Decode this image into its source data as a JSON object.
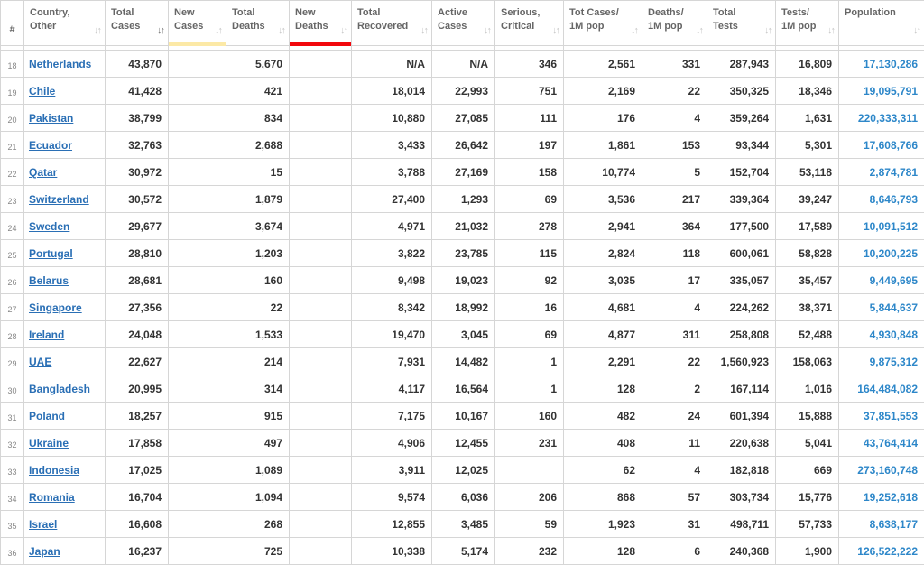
{
  "columns": [
    {
      "key": "rank",
      "l1": "#",
      "l2": ""
    },
    {
      "key": "country",
      "l1": "Country,",
      "l2": "Other"
    },
    {
      "key": "total_cases",
      "l1": "Total",
      "l2": "Cases"
    },
    {
      "key": "new_cases",
      "l1": "New",
      "l2": "Cases"
    },
    {
      "key": "total_deaths",
      "l1": "Total",
      "l2": "Deaths"
    },
    {
      "key": "new_deaths",
      "l1": "New",
      "l2": "Deaths"
    },
    {
      "key": "total_recovered",
      "l1": "Total",
      "l2": "Recovered"
    },
    {
      "key": "active_cases",
      "l1": "Active",
      "l2": "Cases"
    },
    {
      "key": "serious",
      "l1": "Serious,",
      "l2": "Critical"
    },
    {
      "key": "cases_per_m",
      "l1": "Tot Cases/",
      "l2": "1M pop"
    },
    {
      "key": "deaths_per_m",
      "l1": "Deaths/",
      "l2": "1M pop"
    },
    {
      "key": "total_tests",
      "l1": "Total",
      "l2": "Tests"
    },
    {
      "key": "tests_per_m",
      "l1": "Tests/",
      "l2": "1M pop"
    },
    {
      "key": "population",
      "l1": "Population",
      "l2": ""
    }
  ],
  "sort_glyph": "↓↑",
  "rows": [
    {
      "rank": "18",
      "country": "Netherlands",
      "total_cases": "43,870",
      "new_cases": "",
      "total_deaths": "5,670",
      "new_deaths": "",
      "total_recovered": "N/A",
      "active_cases": "N/A",
      "serious": "346",
      "cases_per_m": "2,561",
      "deaths_per_m": "331",
      "total_tests": "287,943",
      "tests_per_m": "16,809",
      "population": "17,130,286"
    },
    {
      "rank": "19",
      "country": "Chile",
      "total_cases": "41,428",
      "new_cases": "",
      "total_deaths": "421",
      "new_deaths": "",
      "total_recovered": "18,014",
      "active_cases": "22,993",
      "serious": "751",
      "cases_per_m": "2,169",
      "deaths_per_m": "22",
      "total_tests": "350,325",
      "tests_per_m": "18,346",
      "population": "19,095,791"
    },
    {
      "rank": "20",
      "country": "Pakistan",
      "total_cases": "38,799",
      "new_cases": "",
      "total_deaths": "834",
      "new_deaths": "",
      "total_recovered": "10,880",
      "active_cases": "27,085",
      "serious": "111",
      "cases_per_m": "176",
      "deaths_per_m": "4",
      "total_tests": "359,264",
      "tests_per_m": "1,631",
      "population": "220,333,311"
    },
    {
      "rank": "21",
      "country": "Ecuador",
      "total_cases": "32,763",
      "new_cases": "",
      "total_deaths": "2,688",
      "new_deaths": "",
      "total_recovered": "3,433",
      "active_cases": "26,642",
      "serious": "197",
      "cases_per_m": "1,861",
      "deaths_per_m": "153",
      "total_tests": "93,344",
      "tests_per_m": "5,301",
      "population": "17,608,766"
    },
    {
      "rank": "22",
      "country": "Qatar",
      "total_cases": "30,972",
      "new_cases": "",
      "total_deaths": "15",
      "new_deaths": "",
      "total_recovered": "3,788",
      "active_cases": "27,169",
      "serious": "158",
      "cases_per_m": "10,774",
      "deaths_per_m": "5",
      "total_tests": "152,704",
      "tests_per_m": "53,118",
      "population": "2,874,781"
    },
    {
      "rank": "23",
      "country": "Switzerland",
      "total_cases": "30,572",
      "new_cases": "",
      "total_deaths": "1,879",
      "new_deaths": "",
      "total_recovered": "27,400",
      "active_cases": "1,293",
      "serious": "69",
      "cases_per_m": "3,536",
      "deaths_per_m": "217",
      "total_tests": "339,364",
      "tests_per_m": "39,247",
      "population": "8,646,793"
    },
    {
      "rank": "24",
      "country": "Sweden",
      "total_cases": "29,677",
      "new_cases": "",
      "total_deaths": "3,674",
      "new_deaths": "",
      "total_recovered": "4,971",
      "active_cases": "21,032",
      "serious": "278",
      "cases_per_m": "2,941",
      "deaths_per_m": "364",
      "total_tests": "177,500",
      "tests_per_m": "17,589",
      "population": "10,091,512"
    },
    {
      "rank": "25",
      "country": "Portugal",
      "total_cases": "28,810",
      "new_cases": "",
      "total_deaths": "1,203",
      "new_deaths": "",
      "total_recovered": "3,822",
      "active_cases": "23,785",
      "serious": "115",
      "cases_per_m": "2,824",
      "deaths_per_m": "118",
      "total_tests": "600,061",
      "tests_per_m": "58,828",
      "population": "10,200,225"
    },
    {
      "rank": "26",
      "country": "Belarus",
      "total_cases": "28,681",
      "new_cases": "",
      "total_deaths": "160",
      "new_deaths": "",
      "total_recovered": "9,498",
      "active_cases": "19,023",
      "serious": "92",
      "cases_per_m": "3,035",
      "deaths_per_m": "17",
      "total_tests": "335,057",
      "tests_per_m": "35,457",
      "population": "9,449,695"
    },
    {
      "rank": "27",
      "country": "Singapore",
      "total_cases": "27,356",
      "new_cases": "",
      "total_deaths": "22",
      "new_deaths": "",
      "total_recovered": "8,342",
      "active_cases": "18,992",
      "serious": "16",
      "cases_per_m": "4,681",
      "deaths_per_m": "4",
      "total_tests": "224,262",
      "tests_per_m": "38,371",
      "population": "5,844,637"
    },
    {
      "rank": "28",
      "country": "Ireland",
      "total_cases": "24,048",
      "new_cases": "",
      "total_deaths": "1,533",
      "new_deaths": "",
      "total_recovered": "19,470",
      "active_cases": "3,045",
      "serious": "69",
      "cases_per_m": "4,877",
      "deaths_per_m": "311",
      "total_tests": "258,808",
      "tests_per_m": "52,488",
      "population": "4,930,848"
    },
    {
      "rank": "29",
      "country": "UAE",
      "total_cases": "22,627",
      "new_cases": "",
      "total_deaths": "214",
      "new_deaths": "",
      "total_recovered": "7,931",
      "active_cases": "14,482",
      "serious": "1",
      "cases_per_m": "2,291",
      "deaths_per_m": "22",
      "total_tests": "1,560,923",
      "tests_per_m": "158,063",
      "population": "9,875,312"
    },
    {
      "rank": "30",
      "country": "Bangladesh",
      "total_cases": "20,995",
      "new_cases": "",
      "total_deaths": "314",
      "new_deaths": "",
      "total_recovered": "4,117",
      "active_cases": "16,564",
      "serious": "1",
      "cases_per_m": "128",
      "deaths_per_m": "2",
      "total_tests": "167,114",
      "tests_per_m": "1,016",
      "population": "164,484,082"
    },
    {
      "rank": "31",
      "country": "Poland",
      "total_cases": "18,257",
      "new_cases": "",
      "total_deaths": "915",
      "new_deaths": "",
      "total_recovered": "7,175",
      "active_cases": "10,167",
      "serious": "160",
      "cases_per_m": "482",
      "deaths_per_m": "24",
      "total_tests": "601,394",
      "tests_per_m": "15,888",
      "population": "37,851,553"
    },
    {
      "rank": "32",
      "country": "Ukraine",
      "total_cases": "17,858",
      "new_cases": "",
      "total_deaths": "497",
      "new_deaths": "",
      "total_recovered": "4,906",
      "active_cases": "12,455",
      "serious": "231",
      "cases_per_m": "408",
      "deaths_per_m": "11",
      "total_tests": "220,638",
      "tests_per_m": "5,041",
      "population": "43,764,414"
    },
    {
      "rank": "33",
      "country": "Indonesia",
      "total_cases": "17,025",
      "new_cases": "",
      "total_deaths": "1,089",
      "new_deaths": "",
      "total_recovered": "3,911",
      "active_cases": "12,025",
      "serious": "",
      "cases_per_m": "62",
      "deaths_per_m": "4",
      "total_tests": "182,818",
      "tests_per_m": "669",
      "population": "273,160,748"
    },
    {
      "rank": "34",
      "country": "Romania",
      "total_cases": "16,704",
      "new_cases": "",
      "total_deaths": "1,094",
      "new_deaths": "",
      "total_recovered": "9,574",
      "active_cases": "6,036",
      "serious": "206",
      "cases_per_m": "868",
      "deaths_per_m": "57",
      "total_tests": "303,734",
      "tests_per_m": "15,776",
      "population": "19,252,618"
    },
    {
      "rank": "35",
      "country": "Israel",
      "total_cases": "16,608",
      "new_cases": "",
      "total_deaths": "268",
      "new_deaths": "",
      "total_recovered": "12,855",
      "active_cases": "3,485",
      "serious": "59",
      "cases_per_m": "1,923",
      "deaths_per_m": "31",
      "total_tests": "498,711",
      "tests_per_m": "57,733",
      "population": "8,638,177"
    },
    {
      "rank": "36",
      "country": "Japan",
      "total_cases": "16,237",
      "new_cases": "",
      "total_deaths": "725",
      "new_deaths": "",
      "total_recovered": "10,338",
      "active_cases": "5,174",
      "serious": "232",
      "cases_per_m": "128",
      "deaths_per_m": "6",
      "total_tests": "240,368",
      "tests_per_m": "1,900",
      "population": "126,522,222"
    }
  ],
  "colors": {
    "new_cases_bar": "#fce9a6",
    "new_deaths_bar": "#f2070d",
    "link": "#2a6fb5",
    "population": "#2d87c9"
  }
}
